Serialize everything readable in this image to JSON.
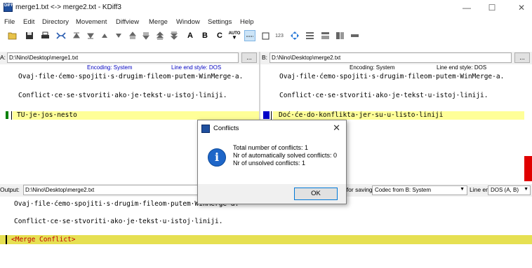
{
  "window": {
    "title": "merge1.txt <-> merge2.txt - KDiff3",
    "app_icon_text": "DIFF",
    "minimize": "—",
    "maximize": "☐",
    "close": "✕"
  },
  "menu": [
    "File",
    "Edit",
    "Directory",
    "Movement",
    "Diffview",
    "Merge",
    "Window",
    "Settings",
    "Help"
  ],
  "toolbar": {
    "icons": [
      "open-icon",
      "save-icon",
      "print-icon",
      "merge-icon",
      "top-icon",
      "bottom-icon",
      "prev-icon",
      "next-icon",
      "prev-conflict-icon",
      "next-conflict-icon",
      "prev-unsolved-icon",
      "next-unsolved-icon",
      "select-a-icon",
      "select-b-icon",
      "select-c-icon",
      "auto-advance-icon",
      "show-whitespace-icon",
      "show-whitespace-chars-icon",
      "line-numbers-icon",
      "word-wrap-icon",
      "overview-icon",
      "split-icon",
      "align-icon",
      "minus-icon"
    ],
    "labels": {
      "a": "A",
      "b": "B",
      "c": "C",
      "auto": "AUTO",
      "num": "123"
    }
  },
  "paneA": {
    "label": "A:",
    "path": "D:\\Nino\\Desktop\\merge1.txt",
    "browse": "...",
    "encoding": "Encoding: System",
    "line_end": "Line end style: DOS",
    "lines": [
      "Ovaj·file·ćemo·spojiti·s·drugim·fileom·putem·WinMerge-a.",
      "",
      "Conflict·ce·se·stvoriti·ako·je·tekst·u·istoj·liniji.",
      "",
      "TU·je·jos·nesto"
    ]
  },
  "paneB": {
    "label": "B:",
    "path": "D:\\Nino\\Desktop\\merge2.txt",
    "browse": "...",
    "encoding": "Encoding: System",
    "line_end": "Line end style: DOS",
    "lines": [
      "Ovaj·file·ćemo·spojiti·s·drugim·fileom·putem·WinMerge-a.",
      "",
      "Conflict·ce·se·stvoriti·ako·je·tekst·u·istoj·liniji.",
      "",
      "Doć·će·do·konflikta·jer·su·u·listo·liniji"
    ]
  },
  "output": {
    "label": "Output:",
    "path": "D:\\Nino\\Desktop\\merge2.txt",
    "encoding_label": "Encoding for saving:",
    "encoding_value": "Codec from B: System",
    "line_end_label": "Line end style:",
    "line_end_value": "DOS (A, B)",
    "lines": [
      "Ovaj·file·ćemo·spojiti·s·drugim·fileom·putem·WinMerge-a.",
      "",
      "Conflict·ce·se·stvoriti·ako·je·tekst·u·istoj·liniji.",
      "",
      "<Merge Conflict>"
    ]
  },
  "dialog": {
    "title": "Conflicts",
    "close": "✕",
    "info_glyph": "i",
    "messages": [
      "Total number of conflicts: 1",
      "Nr of automatically solved conflicts: 0",
      "Nr of unsolved conflicts: 1"
    ],
    "ok": "OK"
  },
  "colors": {
    "diff_highlight": "#ffff98",
    "conflict_highlight": "#e6e052",
    "conflict_text": "#c00000",
    "marker_a": "#008000",
    "marker_b": "#0000c8",
    "overview_conflict": "#e00000"
  }
}
